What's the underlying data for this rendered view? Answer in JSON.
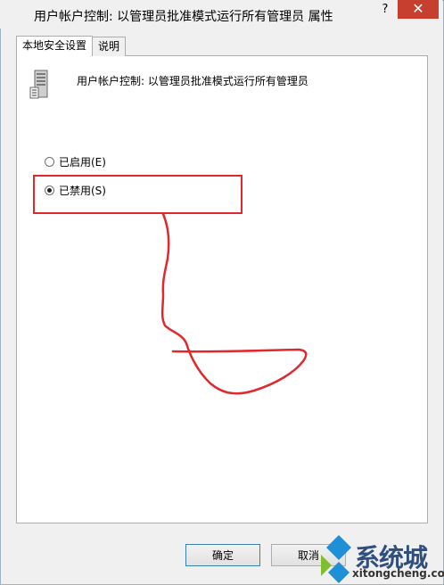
{
  "window": {
    "title": "用户帐户控制: 以管理员批准模式运行所有管理员 属性",
    "help_glyph": "?",
    "close_glyph": "✕"
  },
  "tabs": [
    {
      "label": "本地安全设置",
      "active": true
    },
    {
      "label": "说明",
      "active": false
    }
  ],
  "policy": {
    "name": "用户帐户控制: 以管理员批准模式运行所有管理员",
    "icon": "server-computer-icon"
  },
  "options": [
    {
      "label": "已启用(E)",
      "selected": false
    },
    {
      "label": "已禁用(S)",
      "selected": true
    }
  ],
  "buttons": {
    "ok": "确定",
    "cancel": "取消"
  },
  "watermark": {
    "brand_cn": "系统城",
    "domain": "xitongcheng.com"
  },
  "colors": {
    "close_button": "#c7402f",
    "annotation": "#e0282d",
    "watermark_blue": "#1f8fd6",
    "watermark_green": "#7fbf2f"
  }
}
